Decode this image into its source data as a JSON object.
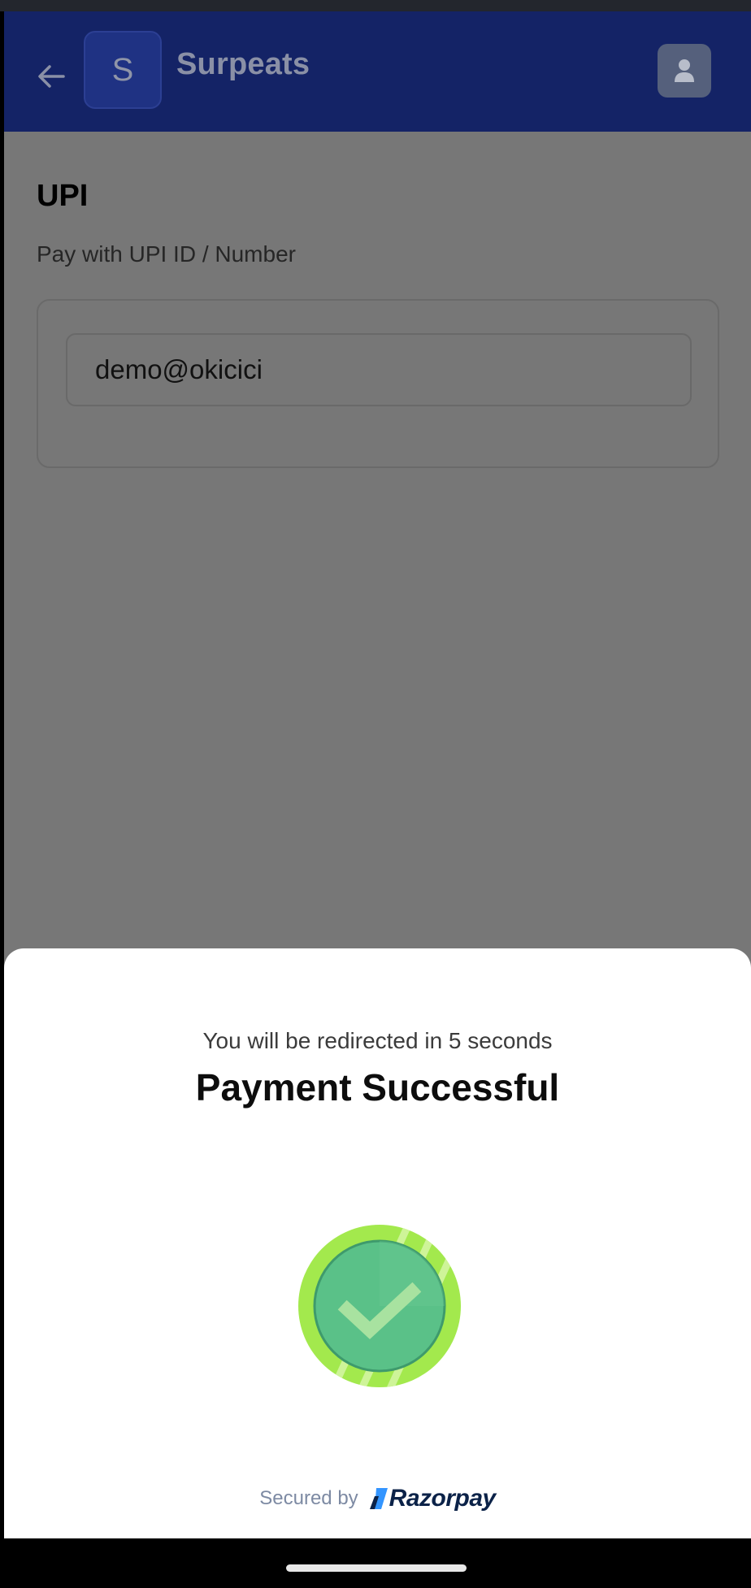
{
  "header": {
    "merchant_initial": "S",
    "merchant_name": "Surpeats",
    "icons": {
      "back": "arrow-left-icon",
      "profile": "user-icon"
    }
  },
  "payment_method": {
    "title": "UPI",
    "subtitle": "Pay with UPI ID / Number",
    "upi_id_value": "demo@okicici"
  },
  "result_sheet": {
    "redirect_message": "You will be redirected in 5 seconds",
    "title": "Payment Successful",
    "status_icon": "check-circle-icon"
  },
  "footer": {
    "secured_by": "Secured by",
    "brand": "Razorpay"
  },
  "colors": {
    "header_bg": "#142366",
    "overlay_bg": "#777777",
    "success_green": "#5ac188",
    "success_ring": "#a3e94d",
    "brand_navy": "#0b2248"
  }
}
